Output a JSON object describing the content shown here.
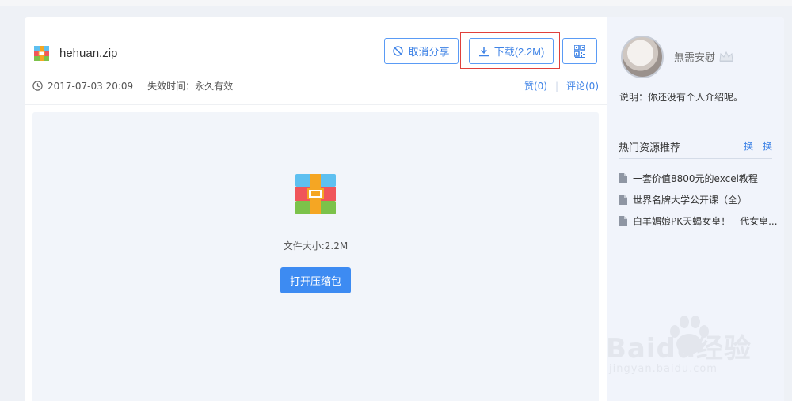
{
  "file": {
    "name": "hehuan.zip",
    "date": "2017-07-03 20:09",
    "expire": "失效时间：永久有效"
  },
  "toolbar": {
    "cancel_label": "取消分享",
    "download_label": "下载(2.2M)"
  },
  "actions": {
    "like": "赞(0)",
    "comment": "评论(0)"
  },
  "preview": {
    "size_text": "文件大小:2.2M",
    "open_label": "打开压缩包"
  },
  "user": {
    "name": "無需安慰",
    "desc": "说明：你还没有个人介绍呢。"
  },
  "hot": {
    "title": "热门资源推荐",
    "refresh": "换一换",
    "items": [
      "一套价值8800元的excel教程",
      "世界名牌大学公开课（全）",
      "白羊媚娘PK天蝎女皇！一代女皇..."
    ]
  },
  "watermark": {
    "main": "Baidu经验",
    "sub": "jingyan.baidu.com"
  },
  "colors": {
    "accent": "#3f83e6",
    "highlight": "#e0403c",
    "panel_bg": "#f1f4fb"
  }
}
